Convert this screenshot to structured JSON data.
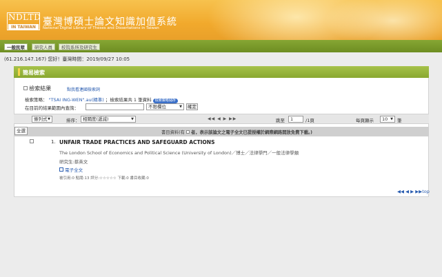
{
  "header": {
    "logo_text": "NDLTD",
    "logo_sub": "IN TAIWAN",
    "title": "臺灣博碩士論文知識加值系統",
    "subtitle": "National Digital Library of Theses and Dissertations in Taiwan"
  },
  "nav": {
    "tabs": [
      {
        "label": "一般民眾"
      },
      {
        "label": "研究人員"
      },
      {
        "label": "校院系所及研究生"
      }
    ]
  },
  "status": {
    "line": "(61.216.147.167) 您好！臺灣時間：2019/09/27 10:05"
  },
  "panel": {
    "title": "簡易檢索",
    "result_heading": "檢索結果",
    "hk_link": "點我看連國檢索詞",
    "strategy_label": "檢索策略：",
    "strategy_query": "\"TSAI ING-WEN\".au(精準)",
    "strategy_count": "；檢索結果共 1 筆資料",
    "save_pill": "檢索策略儲存",
    "within_label": "在目前的結果範圍內查詢：",
    "within_placeholder": "",
    "field_select": "不限欄位",
    "confirm_button": "確定"
  },
  "toolbar": {
    "format_select": "條列式",
    "sort_label": "排序：",
    "sort_select": "相關度(遞減)",
    "nav_arrows": "◀◀ ◀ ▶ ▶▶",
    "jump_label": "跳至",
    "jump_value": "1",
    "page_total": "/1頁",
    "per_page_label": "每頁顯示",
    "per_page_value": "10",
    "per_page_unit": "筆"
  },
  "results_bar": {
    "all_button": "全選",
    "note_prefix": "書目資料(有",
    "note_suffix": "者，表示該論文之電子全文已提授權於網際網路開放免費下載。)"
  },
  "results": [
    {
      "index": "1.",
      "title": "UNFAIR TRADE PRACTICES AND SAFEGUARD ACTIONS",
      "institution": "The London School of Economics and Political Science (University of London)／博士／法律學門／一般法律學類",
      "author": "研究生:蔡英文",
      "fulltext": "電子全文",
      "stats": "被引用:0  點閱:13  評分:☆☆☆☆☆  下載:0  書目收藏:0"
    }
  ],
  "footer": {
    "nav": "◀◀ ◀ ▶ ▶▶top"
  },
  "colors": {
    "header": "#f1a92c",
    "nav": "#6e8d22",
    "panel_head": "#89a830",
    "link": "#2a5db0"
  }
}
